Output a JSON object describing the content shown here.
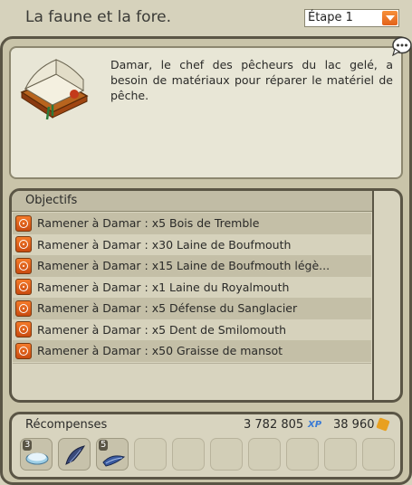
{
  "window": {
    "title": "La faune et la fore.",
    "step_selected": "Étape 1"
  },
  "description": "Damar, le chef des pêcheurs du lac gelé, a besoin de matériaux pour réparer le matériel de pêche.",
  "objectives": {
    "header": "Objectifs",
    "items": [
      "Ramener à Damar : x5 Bois de Tremble",
      "Ramener à Damar : x30 Laine de Boufmouth",
      "Ramener à Damar : x15 Laine de Boufmouth légè...",
      "Ramener à Damar : x1 Laine du Royalmouth",
      "Ramener à Damar : x5 Défense du Sanglacier",
      "Ramener à Damar : x5 Dent de Smilomouth",
      "Ramener à Damar : x50 Graisse de mansot"
    ]
  },
  "rewards": {
    "label": "Récompenses",
    "xp": "3 782 805",
    "xp_tag": "XP",
    "kamas": "38 960",
    "items": [
      {
        "count": "3",
        "icon": "snowball-icon"
      },
      {
        "count": "",
        "icon": "feather-icon"
      },
      {
        "count": "5",
        "icon": "blue-feather-icon"
      }
    ]
  },
  "colors": {
    "accent": "#f0781f",
    "frame": "#5a5545",
    "panel": "#d6d2bc"
  }
}
